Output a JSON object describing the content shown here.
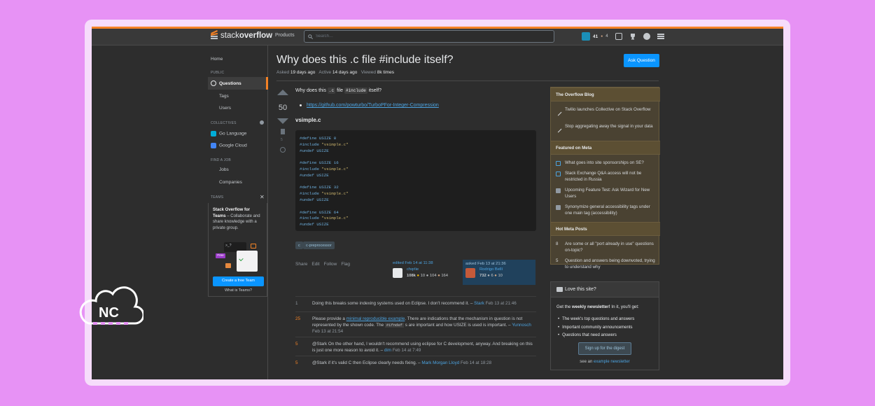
{
  "topbar": {
    "logo_light": "stack",
    "logo_bold": "overflow",
    "nav_products": "Products",
    "search_placeholder": "Search…",
    "reputation": "41",
    "badge_dot": "●",
    "badge_count": "4"
  },
  "leftnav": {
    "home": "Home",
    "public_label": "PUBLIC",
    "questions": "Questions",
    "tags": "Tags",
    "users": "Users",
    "collectives_label": "COLLECTIVES",
    "collectives": [
      {
        "label": "Go Language",
        "color": "#00acd7"
      },
      {
        "label": "Google Cloud",
        "color": "#4285f4"
      }
    ],
    "find_job_label": "FIND A JOB",
    "jobs": "Jobs",
    "companies": "Companies",
    "teams_label": "TEAMS",
    "teams_title": "Stack Overflow for Teams",
    "teams_dash": " – ",
    "teams_text": "Collaborate and share knowledge with a private group.",
    "teams_free": "Free",
    "teams_button": "Create a free Team",
    "teams_link": "What is Teams?"
  },
  "question": {
    "title": "Why does this .c file #include itself?",
    "asked_label": "Asked",
    "asked_value": "19 days ago",
    "active_label": "Active",
    "active_value": "14 days ago",
    "viewed_label": "Viewed",
    "viewed_value": "8k times",
    "ask_button": "Ask Question",
    "votes": "50",
    "bookmarks": "5",
    "body_pre": "Why does this",
    "body_code1": ".c",
    "body_mid": "file",
    "body_code2": "#include",
    "body_post": "itself?",
    "link": "https://github.com/powturbo/TurboPFor-Integer-Compression",
    "heading": "vsimple.c",
    "code_lines": [
      {
        "kw": "#define",
        "rest": " USIZE 8"
      },
      {
        "kw": "#include",
        "str": " \"vsimple.c\""
      },
      {
        "kw": "#undef",
        "rest": " USIZE"
      },
      {
        "blank": true
      },
      {
        "kw": "#define",
        "rest": " USIZE 16"
      },
      {
        "kw": "#include",
        "str": " \"vsimple.c\""
      },
      {
        "kw": "#undef",
        "rest": " USIZE"
      },
      {
        "blank": true
      },
      {
        "kw": "#define",
        "rest": " USIZE 32"
      },
      {
        "kw": "#include",
        "str": " \"vsimple.c\""
      },
      {
        "kw": "#undef",
        "rest": " USIZE"
      },
      {
        "blank": true
      },
      {
        "kw": "#define",
        "rest": " USIZE 64"
      },
      {
        "kw": "#include",
        "str": " \"vsimple.c\""
      },
      {
        "kw": "#undef",
        "rest": " USIZE"
      }
    ],
    "tags": [
      "c",
      "c-preprocessor"
    ],
    "actions": [
      "Share",
      "Edit",
      "Follow",
      "Flag"
    ],
    "edited": {
      "label": "edited Feb 14 at 11:38",
      "name": "chqrlie",
      "rep": "108k",
      "gold": "10",
      "silver": "104",
      "bronze": "164"
    },
    "asked": {
      "label": "asked Feb 13 at 21:36",
      "name": "Rodrigo Bellí",
      "rep": "732",
      "gold": "6",
      "silver": "10"
    }
  },
  "comments": [
    {
      "score": "1",
      "hot": false,
      "text": "Doing this breaks some indexing systems used on Eclipse. I don't recommend it. – ",
      "user": "Stark",
      "date": "Feb 13 at 21:46"
    },
    {
      "score": "25",
      "hot": true,
      "pre": "Please provide a ",
      "link": "minimal reproducible example",
      "text": ". There are indications that the mechanism in question is not represented by the shown code. The ",
      "code": "#ifndef",
      "text2": " s are important and how USIZE is used is important. – ",
      "user": "Yunnosch",
      "date": "Feb 13 at 21:54"
    },
    {
      "score": "5",
      "hot": false,
      "text": "@Stark On the other hand, I wouldn't recommend using eclipse for C development, anyway. And breaking on this is just one more reason to avoid it. – ",
      "user": "dim",
      "date": "Feb 14 at 7:49"
    },
    {
      "score": "5",
      "hot": false,
      "text": "@Stark if it's valid C then Eclipse clearly needs fixing. – ",
      "user": "Mark Morgan Lloyd",
      "date": "Feb 14 at 18:28"
    }
  ],
  "sidebar": {
    "blog_title": "The Overflow Blog",
    "blog_items": [
      "Twilio launches Collective on Stack Overflow",
      "Stop aggregating away the signal in your data"
    ],
    "meta_title": "Featured on Meta",
    "meta_items": [
      "What goes into site sponsorships on SE?",
      "Stack Exchange Q&A access will not be restricted in Russia",
      "Upcoming Feature Test: Ask Wizard for New Users",
      "Synonymize general accessibility tags under one main tag (accessibility)"
    ],
    "hot_title": "Hot Meta Posts",
    "hot_items": [
      {
        "n": "8",
        "text": "Are some or all \"port already in use\" questions on-topic?"
      },
      {
        "n": "5",
        "text": "Question and answers being downvoted, trying to understand why"
      }
    ],
    "love_title": "Love this site?",
    "love_pre": "Get the ",
    "love_bold": "weekly newsletter!",
    "love_post": " In it, you'll get:",
    "love_list": [
      "The week's top questions and answers",
      "Important community announcements",
      "Questions that need answers"
    ],
    "digest_button": "Sign up for the digest",
    "see_an": "see an ",
    "example_link": "example newsletter"
  },
  "watermark": {
    "text": "NC"
  }
}
